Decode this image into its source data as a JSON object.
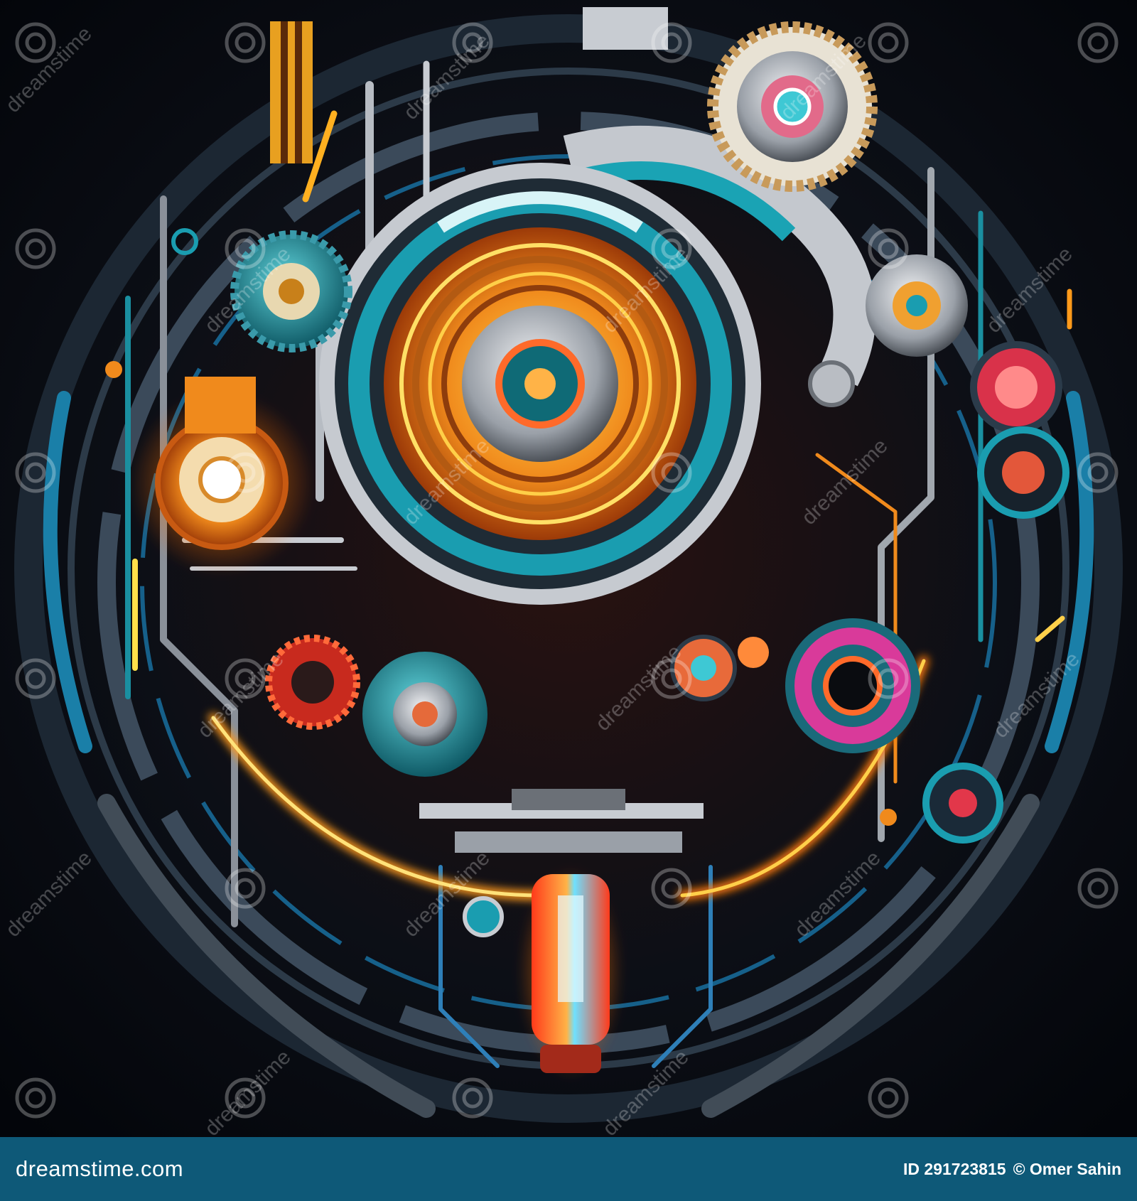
{
  "footer": {
    "brand": "dreamstime.com",
    "id_text": "ID 291723815",
    "author_text": "© Omer Sahin",
    "bar_color": "#0e5978"
  },
  "image": {
    "watermark_icon": "swirl-logo-icon",
    "watermark_text": "dreamstime",
    "palette": [
      "#07090d",
      "#1a8fa0",
      "#f08a1c",
      "#ffd23a",
      "#c8ccd2",
      "#e02a1a",
      "#d93a9a"
    ]
  }
}
